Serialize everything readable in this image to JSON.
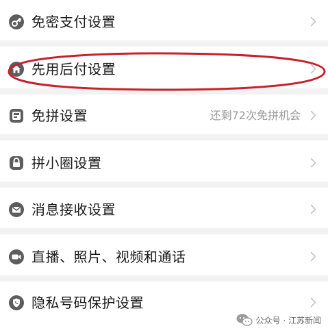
{
  "settings": {
    "items": [
      {
        "label": "免密支付设置",
        "value": "",
        "icon": "key-icon"
      },
      {
        "label": "先用后付设置",
        "value": "",
        "icon": "house-icon"
      },
      {
        "label": "免拼设置",
        "value": "还剩72次免拼机会",
        "icon": "ticket-icon"
      },
      {
        "label": "拼小圈设置",
        "value": "",
        "icon": "lock-icon"
      },
      {
        "label": "消息接收设置",
        "value": "",
        "icon": "mail-icon"
      },
      {
        "label": "直播、照片、视频和通话",
        "value": "",
        "icon": "video-camera-icon"
      },
      {
        "label": "隐私号码保护设置",
        "value": "",
        "icon": "phone-shield-icon"
      }
    ]
  },
  "annotation": {
    "color": "#c8202d",
    "highlighted_item": "先用后付设置"
  },
  "watermark": {
    "text": "公众号 · 江苏新闻",
    "icon": "wechat-logo-icon"
  },
  "colors": {
    "icon": "#5d5d5d",
    "text": "#1a1a1a",
    "secondary_text": "#9a9a9a",
    "chevron": "#c6c6c6",
    "divider": "#f2f2f2"
  }
}
